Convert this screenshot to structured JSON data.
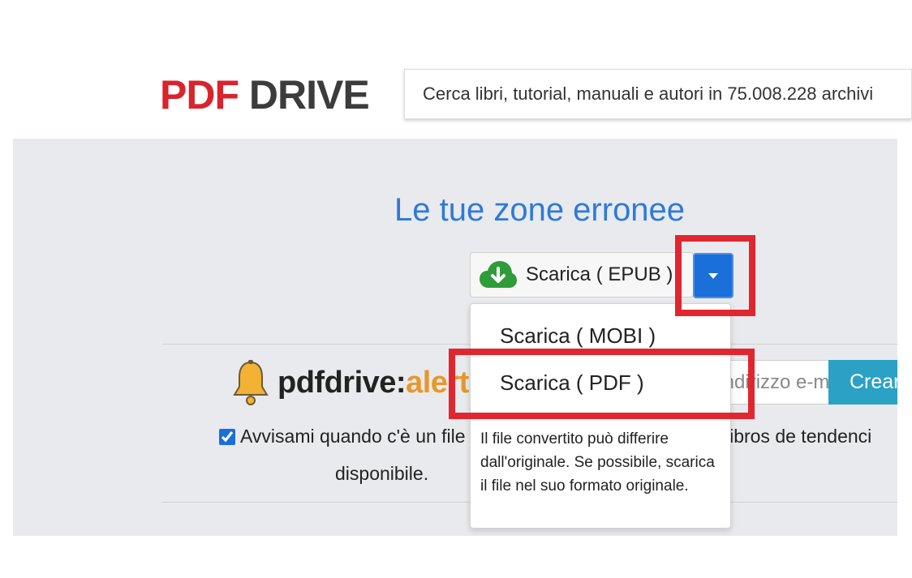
{
  "header": {
    "logo_part1": "PDF",
    "logo_part2": "DRIVE",
    "search_placeholder": "Cerca libri, tutorial, manuali e autori in 75.008.228 archivi"
  },
  "main": {
    "title": "Le tue zone erronee",
    "download_button_label": "Scarica ( EPUB )",
    "dropdown": {
      "items": [
        "Scarica ( MOBI )",
        "Scarica ( PDF )"
      ],
      "note": "Il file convertito può differire dall'originale. Se possibile, scarica il file nel suo formato originale."
    },
    "alert": {
      "brand_part1": "pdfdrive:",
      "brand_part2": "alert",
      "email_placeholder": "Indirizzo e-mail elettronico",
      "create_label": "Crear"
    },
    "notify": {
      "text": "Avvisami quando c'è un file",
      "text_tail": "ne libros de tendenci",
      "line2": "disponibile.",
      "checked": true
    }
  },
  "colors": {
    "logo_red": "#d9232d",
    "title_blue": "#2e7ad8",
    "caret_blue": "#1a6fd8",
    "create_teal": "#2aa1c5",
    "highlight_red": "#e0262f",
    "alert_orange": "#e8972c",
    "cloud_green": "#2f9c3a"
  },
  "icons": {
    "download": "cloud-download-icon",
    "bell": "bell-icon",
    "caret": "caret-down-icon"
  }
}
